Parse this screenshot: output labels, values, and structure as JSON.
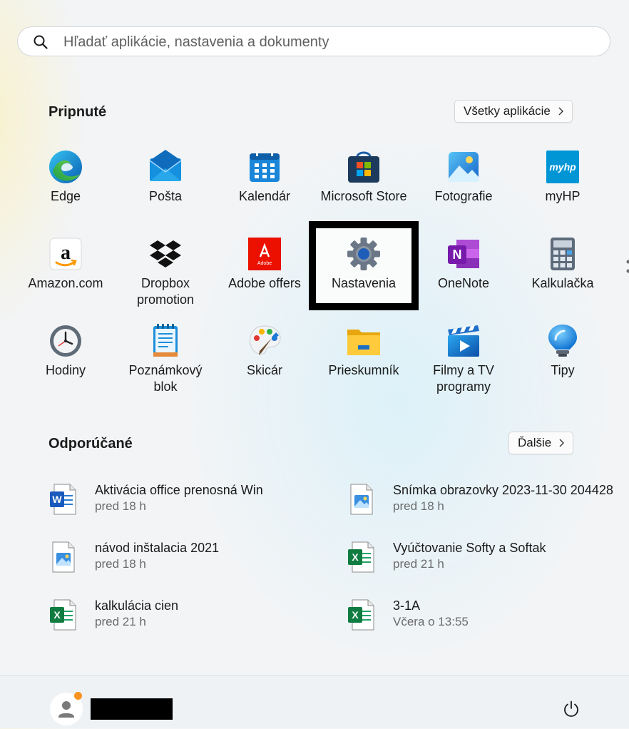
{
  "search": {
    "placeholder": "Hľadať aplikácie, nastavenia a dokumenty"
  },
  "pinned": {
    "title": "Pripnuté",
    "all_apps_label": "Všetky aplikácie",
    "apps": [
      {
        "label": "Edge",
        "icon": "edge-icon"
      },
      {
        "label": "Pošta",
        "icon": "mail-icon"
      },
      {
        "label": "Kalendár",
        "icon": "calendar-icon"
      },
      {
        "label": "Microsoft Store",
        "icon": "store-icon"
      },
      {
        "label": "Fotografie",
        "icon": "photos-icon"
      },
      {
        "label": "myHP",
        "icon": "myhp-icon"
      },
      {
        "label": "Amazon.com",
        "icon": "amazon-icon"
      },
      {
        "label": "Dropbox promotion",
        "icon": "dropbox-icon"
      },
      {
        "label": "Adobe offers",
        "icon": "adobe-icon"
      },
      {
        "label": "Nastavenia",
        "icon": "gear-icon"
      },
      {
        "label": "OneNote",
        "icon": "onenote-icon"
      },
      {
        "label": "Kalkulačka",
        "icon": "calculator-icon"
      },
      {
        "label": "Hodiny",
        "icon": "clock-icon"
      },
      {
        "label": "Poznámkový blok",
        "icon": "notepad-icon"
      },
      {
        "label": "Skicár",
        "icon": "paint-icon"
      },
      {
        "label": "Prieskumník",
        "icon": "folder-icon"
      },
      {
        "label": "Filmy a TV programy",
        "icon": "movies-icon"
      },
      {
        "label": "Tipy",
        "icon": "lightbulb-icon"
      }
    ],
    "myhp_text": "myhp",
    "adobe_text": "Adobe",
    "onenote_letter": "N"
  },
  "recommended": {
    "title": "Odporúčané",
    "more_label": "Ďalšie",
    "items": [
      {
        "name": "Aktivácia office prenosná Win",
        "time": "pred 18 h",
        "type": "word"
      },
      {
        "name": "Snímka obrazovky 2023-11-30 204428",
        "time": "pred 18 h",
        "type": "image"
      },
      {
        "name": "návod inštalacia 2021",
        "time": "pred 18 h",
        "type": "image"
      },
      {
        "name": "Vyúčtovanie Softy a Softak",
        "time": "pred 21 h",
        "type": "excel"
      },
      {
        "name": "kalkulácia cien",
        "time": "pred 21 h",
        "type": "excel"
      },
      {
        "name": "3-1A",
        "time": "Včera o 13:55",
        "type": "excel"
      }
    ]
  },
  "colors": {
    "accent": "#0067c0",
    "highlight_border": "#000000",
    "notification_dot": "#f7931e"
  }
}
